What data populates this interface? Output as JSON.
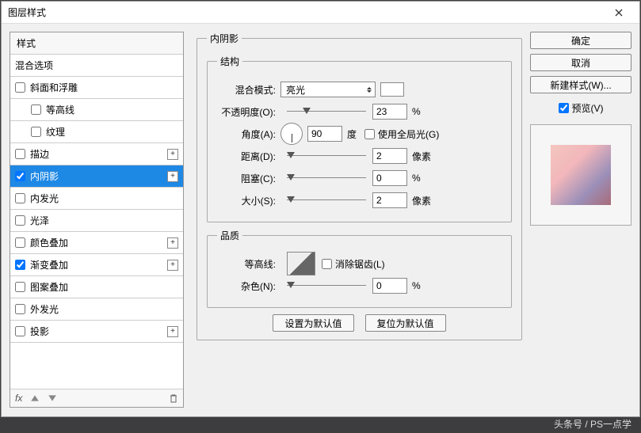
{
  "titlebar": {
    "title": "图层样式"
  },
  "sidebar": {
    "header": "样式",
    "blending": "混合选项",
    "items": [
      {
        "label": "斜面和浮雕",
        "checked": false,
        "plus": false,
        "indent": false
      },
      {
        "label": "等高线",
        "checked": false,
        "plus": false,
        "indent": true
      },
      {
        "label": "纹理",
        "checked": false,
        "plus": false,
        "indent": true
      },
      {
        "label": "描边",
        "checked": false,
        "plus": true,
        "indent": false
      },
      {
        "label": "内阴影",
        "checked": true,
        "plus": true,
        "indent": false,
        "selected": true
      },
      {
        "label": "内发光",
        "checked": false,
        "plus": false,
        "indent": false
      },
      {
        "label": "光泽",
        "checked": false,
        "plus": false,
        "indent": false
      },
      {
        "label": "颜色叠加",
        "checked": false,
        "plus": true,
        "indent": false
      },
      {
        "label": "渐变叠加",
        "checked": true,
        "plus": true,
        "indent": false
      },
      {
        "label": "图案叠加",
        "checked": false,
        "plus": false,
        "indent": false
      },
      {
        "label": "外发光",
        "checked": false,
        "plus": false,
        "indent": false
      },
      {
        "label": "投影",
        "checked": false,
        "plus": true,
        "indent": false
      }
    ],
    "fx_label": "fx"
  },
  "main": {
    "panel_title": "内阴影",
    "structure_title": "结构",
    "blend_mode_label": "混合模式:",
    "blend_mode_value": "亮光",
    "opacity_label": "不透明度(O):",
    "opacity_value": "23",
    "opacity_unit": "%",
    "angle_label": "角度(A):",
    "angle_value": "90",
    "angle_unit": "度",
    "global_light": "使用全局光(G)",
    "distance_label": "距离(D):",
    "distance_value": "2",
    "distance_unit": "像素",
    "choke_label": "阻塞(C):",
    "choke_value": "0",
    "choke_unit": "%",
    "size_label": "大小(S):",
    "size_value": "2",
    "size_unit": "像素",
    "quality_title": "品质",
    "contour_label": "等高线:",
    "antialias": "消除锯齿(L)",
    "noise_label": "杂色(N):",
    "noise_value": "0",
    "noise_unit": "%",
    "default_btn": "设置为默认值",
    "reset_btn": "复位为默认值"
  },
  "right": {
    "ok": "确定",
    "cancel": "取消",
    "newstyle": "新建样式(W)...",
    "preview": "预览(V)"
  },
  "watermark": "头条号 / PS一点学"
}
